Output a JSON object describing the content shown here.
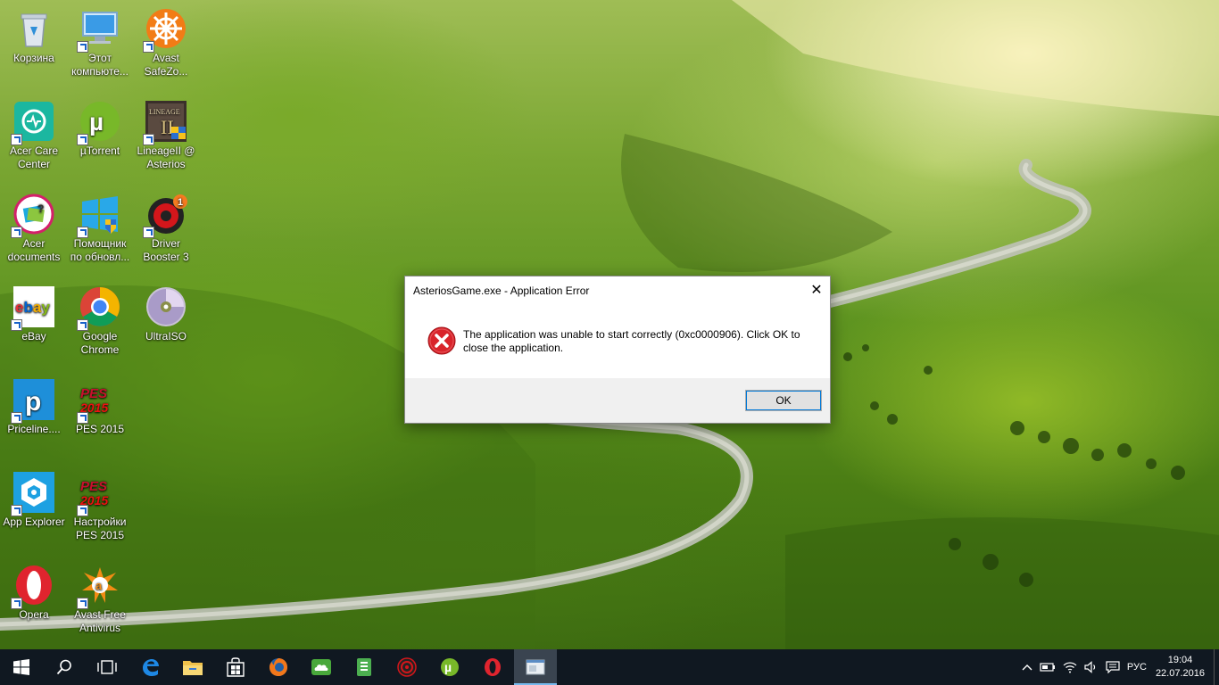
{
  "desktop": {
    "icons": [
      {
        "label": "Корзина"
      },
      {
        "label": "Этот компьюте..."
      },
      {
        "label": "Avast SafeZo..."
      },
      {
        "label": "Acer Care Center"
      },
      {
        "label": "µTorrent"
      },
      {
        "label": "LineageII @ Asterios"
      },
      {
        "label": "Acer documents"
      },
      {
        "label": "Помощник по обновл..."
      },
      {
        "label": "Driver Booster 3",
        "badge": "1"
      },
      {
        "label": "eBay",
        "logo_text": "ebay"
      },
      {
        "label": "Google Chrome"
      },
      {
        "label": "UltraISO"
      },
      {
        "label": "Priceline...."
      },
      {
        "label": "PES 2015",
        "logo_text": "PES 2015"
      },
      {
        "label": "App Explorer"
      },
      {
        "label": "Настройки PES 2015",
        "logo_text": "PES 2015"
      },
      {
        "label": "Opera"
      },
      {
        "label": "Avast Free Antivirus"
      }
    ]
  },
  "dialog": {
    "title": "AsteriosGame.exe - Application Error",
    "close_glyph": "✕",
    "message": "The application was unable to start correctly (0xc0000906). Click OK to close the application.",
    "ok_label": "OK",
    "icon": "error-icon"
  },
  "taskbar": {
    "items": [
      "start-icon",
      "search-icon",
      "task-view-icon",
      "edge-icon",
      "file-explorer-icon",
      "store-icon",
      "firefox-icon",
      "cloud-app-icon",
      "green-app-icon",
      "driver-booster-icon",
      "utorrent-icon",
      "opera-icon",
      "active-window-icon"
    ],
    "tray": {
      "language": "РУС",
      "time": "19:04",
      "date": "22.07.2016"
    }
  },
  "colors": {
    "taskbar": "#101821",
    "accent": "#0078d7",
    "error_red": "#d9242b"
  }
}
